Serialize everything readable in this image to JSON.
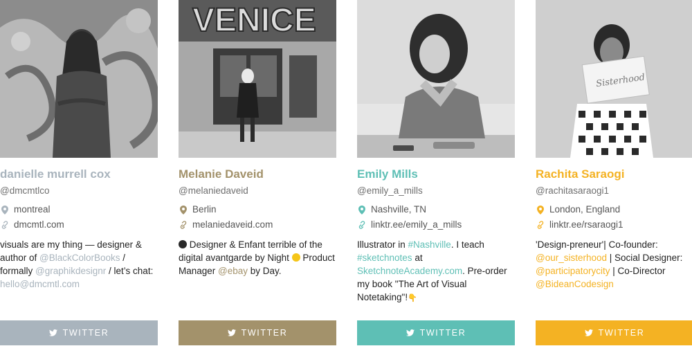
{
  "profiles": [
    {
      "accent": "#a9b4bd",
      "name": "danielle murrell cox",
      "handle": "@dmcmtlco",
      "location": "montreal",
      "website": "dmcmtl.com",
      "bio": [
        {
          "t": "visuals are my thing — designer & author of "
        },
        {
          "t": "@BlackColorBooks",
          "link": true
        },
        {
          "t": " / formally "
        },
        {
          "t": "@graphikdesignr",
          "link": true
        },
        {
          "t": " / let’s chat: "
        },
        {
          "t": "hello@dmcmtl.com",
          "link": true
        }
      ],
      "twitter_label": "TWITTER",
      "icons": {
        "location": "map-pin-icon",
        "website": "link-icon",
        "twitter": "twitter-bird-icon"
      }
    },
    {
      "accent": "#a3926b",
      "name": "Melanie Daveid",
      "handle": "@melaniedaveid",
      "location": "Berlin",
      "website": "melaniedaveid.com",
      "bio": [
        {
          "emoji": "#2a2a2a"
        },
        {
          "t": "  Designer & Enfant terrible of the digital avantgarde by Night "
        },
        {
          "emoji": "#f5c518"
        },
        {
          "t": " Product Manager "
        },
        {
          "t": "@ebay",
          "link": true
        },
        {
          "t": " by Day."
        }
      ],
      "twitter_label": "TWITTER",
      "icons": {
        "location": "map-pin-icon",
        "website": "link-icon",
        "twitter": "twitter-bird-icon"
      }
    },
    {
      "accent": "#5ebfb5",
      "name": "Emily Mills",
      "handle": "@emily_a_mills",
      "location": "Nashville, TN",
      "website": "linktr.ee/emily_a_mills",
      "bio": [
        {
          "t": "Illustrator in "
        },
        {
          "t": "#Nashville",
          "link": true
        },
        {
          "t": ". I teach "
        },
        {
          "t": "#sketchnotes",
          "link": true
        },
        {
          "t": " at "
        },
        {
          "t": "SketchnoteAcademy.com",
          "link": true
        },
        {
          "t": ". Pre-order my book \"The Art of Visual Notetaking\"!"
        },
        {
          "t": "👇",
          "hand": true
        }
      ],
      "twitter_label": "TWITTER",
      "icons": {
        "location": "map-pin-icon",
        "website": "link-icon",
        "twitter": "twitter-bird-icon"
      }
    },
    {
      "accent": "#f4b223",
      "name": "Rachita Saraogi",
      "handle": "@rachitasaraogi1",
      "location": "London, England",
      "website": "linktr.ee/rsaraogi1",
      "bio": [
        {
          "t": "'Design-preneur'| Co-founder: "
        },
        {
          "t": "@our_sisterhood",
          "link": true
        },
        {
          "t": " | Social Designer: "
        },
        {
          "t": "@participatorycity",
          "link": true
        },
        {
          "t": " | Co-Director "
        },
        {
          "t": "@BideanCodesign",
          "link": true
        }
      ],
      "twitter_label": "TWITTER",
      "photo_sign_text": "Sisterhood",
      "icons": {
        "location": "map-pin-icon",
        "website": "link-icon",
        "twitter": "twitter-bird-icon"
      }
    }
  ]
}
